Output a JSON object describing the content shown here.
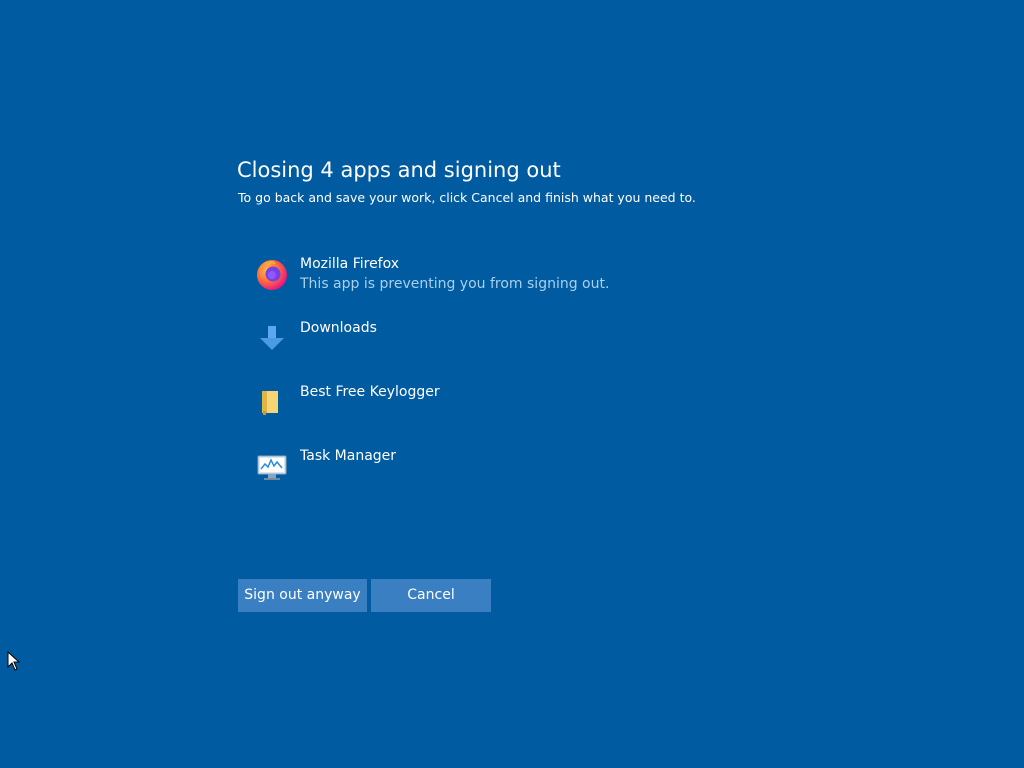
{
  "dialog": {
    "title": "Closing 4 apps and signing out",
    "subtitle": "To go back and save your work, click Cancel and finish what you need to."
  },
  "apps": [
    {
      "name": "Mozilla Firefox",
      "status": "This app is preventing you from signing out.",
      "icon": "firefox-icon"
    },
    {
      "name": "Downloads",
      "icon": "download-arrow-icon"
    },
    {
      "name": "Best Free Keylogger",
      "icon": "folder-icon"
    },
    {
      "name": "Task Manager",
      "icon": "task-manager-icon"
    }
  ],
  "buttons": {
    "sign_out_anyway": "Sign out anyway",
    "cancel": "Cancel"
  },
  "colors": {
    "background": "#005ba1",
    "button": "#3a7fc1",
    "status_text": "#a8d0f0"
  }
}
